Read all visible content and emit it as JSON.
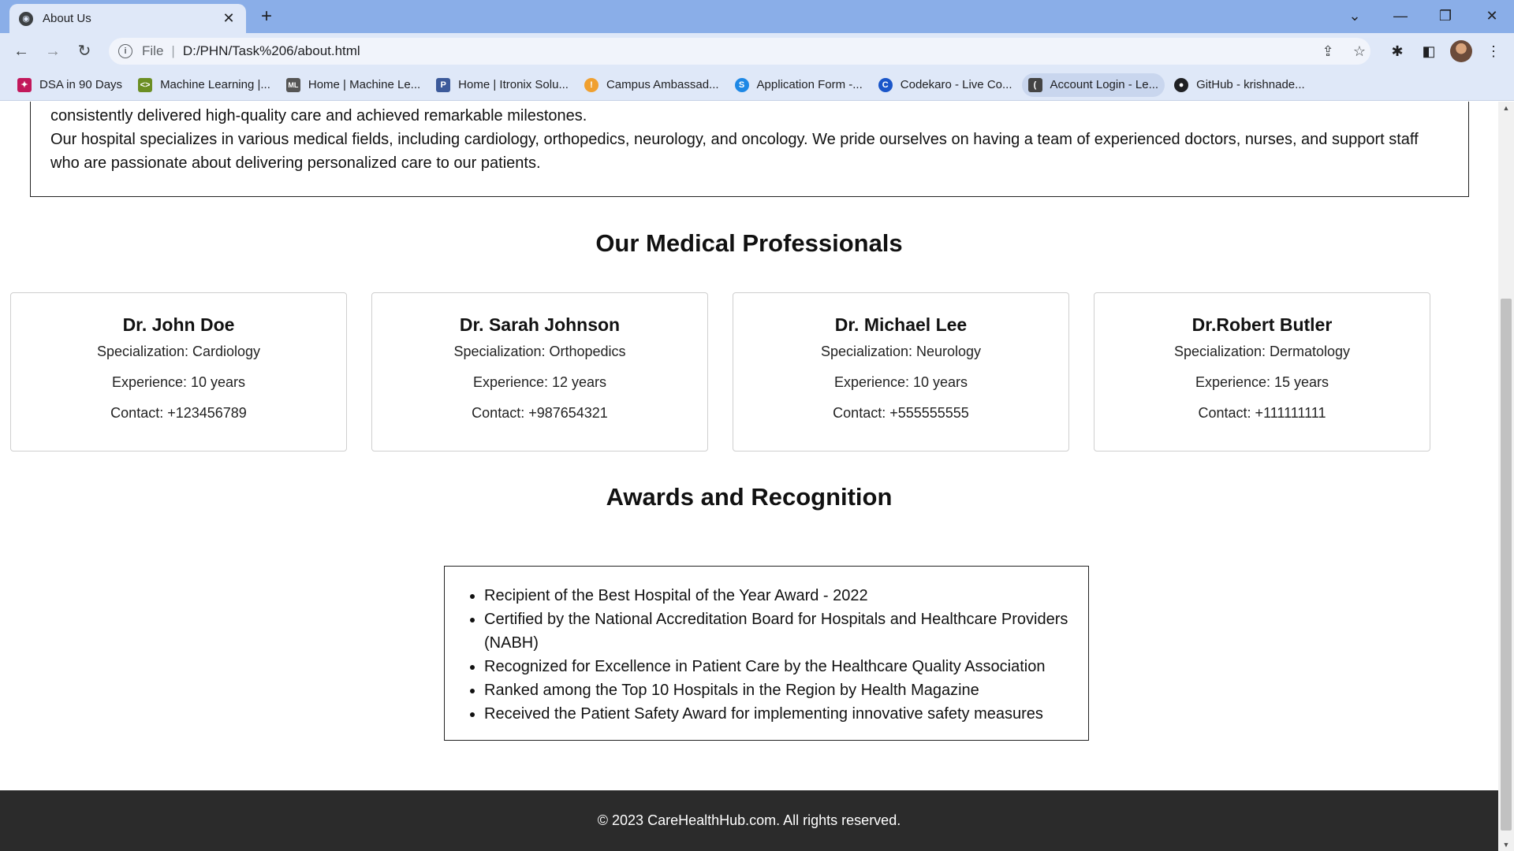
{
  "browser": {
    "tab_title": "About Us",
    "tab_close": "✕",
    "new_tab": "+",
    "tab_search": "⌄",
    "minimize": "—",
    "restore": "❐",
    "close": "✕",
    "back": "←",
    "forward": "→",
    "reload": "↻",
    "scheme": "File",
    "url": "D:/PHN/Task%206/about.html",
    "share_icon": "⇪",
    "star_icon": "☆",
    "extensions_icon": "✱",
    "sidepanel_icon": "◧",
    "menu_icon": "⋮"
  },
  "bookmarks": [
    {
      "label": "DSA in 90 Days",
      "icon_text": "✦",
      "color": "#c2185b"
    },
    {
      "label": "Machine Learning |...",
      "icon_text": "<>",
      "color": "#6b8e23"
    },
    {
      "label": "Home | Machine Le...",
      "icon_text": "ML",
      "color": "#555555"
    },
    {
      "label": "Home | Itronix Solu...",
      "icon_text": "P",
      "color": "#3c5a9a"
    },
    {
      "label": "Campus Ambassad...",
      "icon_text": "!",
      "color": "#f0a030"
    },
    {
      "label": "Application Form -...",
      "icon_text": "S",
      "color": "#1e88e5"
    },
    {
      "label": "Codekaro - Live Co...",
      "icon_text": "C",
      "color": "#1a56c9"
    },
    {
      "label": "Account Login - Le...",
      "icon_text": "(",
      "color": "#444444"
    },
    {
      "label": "GitHub - krishnade...",
      "icon_text": "●",
      "color": "#202124"
    }
  ],
  "about": {
    "line1": "consistently delivered high-quality care and achieved remarkable milestones.",
    "line2": "Our hospital specializes in various medical fields, including cardiology, orthopedics, neurology, and oncology. We pride ourselves on having a team of experienced doctors, nurses, and support staff who are passionate about delivering personalized care to our patients."
  },
  "professionals": {
    "heading": "Our Medical Professionals",
    "doctors": [
      {
        "name": "Dr. John Doe",
        "specialization": "Specialization: Cardiology",
        "experience": "Experience: 10 years",
        "contact": "Contact: +123456789"
      },
      {
        "name": "Dr. Sarah Johnson",
        "specialization": "Specialization: Orthopedics",
        "experience": "Experience: 12 years",
        "contact": "Contact: +987654321"
      },
      {
        "name": "Dr. Michael Lee",
        "specialization": "Specialization: Neurology",
        "experience": "Experience: 10 years",
        "contact": "Contact: +555555555"
      },
      {
        "name": "Dr.Robert Butler",
        "specialization": "Specialization: Dermatology",
        "experience": "Experience: 15 years",
        "contact": "Contact: +111111111"
      }
    ]
  },
  "awards": {
    "heading": "Awards and Recognition",
    "items": [
      "Recipient of the Best Hospital of the Year Award - 2022",
      "Certified by the National Accreditation Board for Hospitals and Healthcare Providers (NABH)",
      "Recognized for Excellence in Patient Care by the Healthcare Quality Association",
      "Ranked among the Top 10 Hospitals in the Region by Health Magazine",
      "Received the Patient Safety Award for implementing innovative safety measures"
    ]
  },
  "footer": {
    "text": "© 2023 CareHealthHub.com. All rights reserved."
  }
}
